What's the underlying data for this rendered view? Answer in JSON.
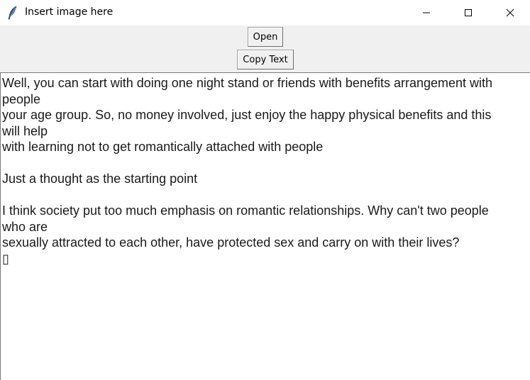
{
  "window": {
    "title": "Insert image here",
    "icon": "feather-icon"
  },
  "toolbar": {
    "open_label": "Open",
    "copy_label": "Copy Text"
  },
  "text": {
    "lines": [
      "Well, you can start with doing one night stand or friends with benefits arrangement with",
      "people",
      "your age group. So, no money involved, just enjoy the happy physical benefits and this",
      "will help",
      "with learning not to get romantically attached with people",
      "",
      "Just a thought as the starting point",
      "",
      "I think society put too much emphasis on romantic relationships. Why can't two people",
      "who are",
      "sexually attracted to each other, have protected sex and carry on with their lives?",
      "▯"
    ]
  }
}
